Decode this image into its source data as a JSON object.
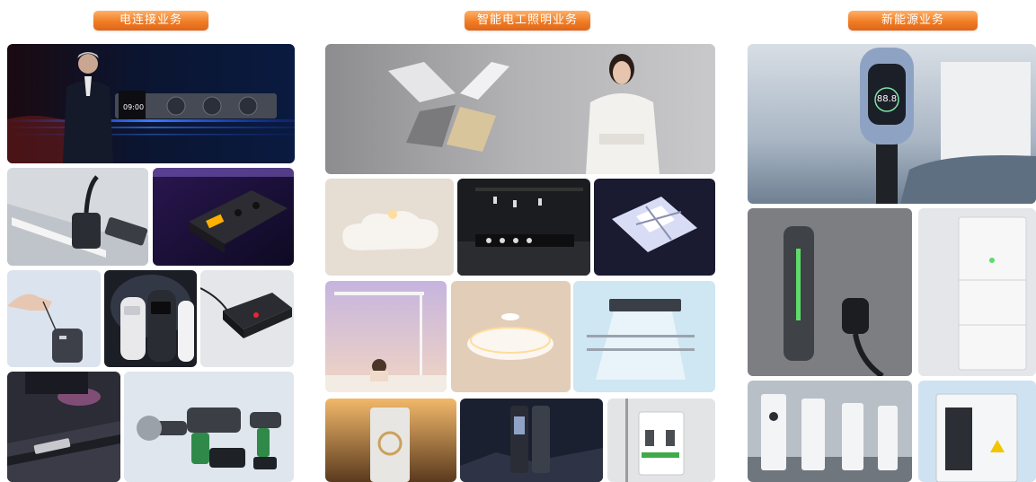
{
  "sections": [
    {
      "title": "电连接业务"
    },
    {
      "title": "智能电工照明业务"
    },
    {
      "title": "新能源业务"
    }
  ],
  "hero_connect": {
    "clock": "09:00"
  },
  "ev_charger": {
    "display": "88.8"
  },
  "colors": {
    "accent": "#f07d25",
    "accent_light": "#ffb067"
  }
}
